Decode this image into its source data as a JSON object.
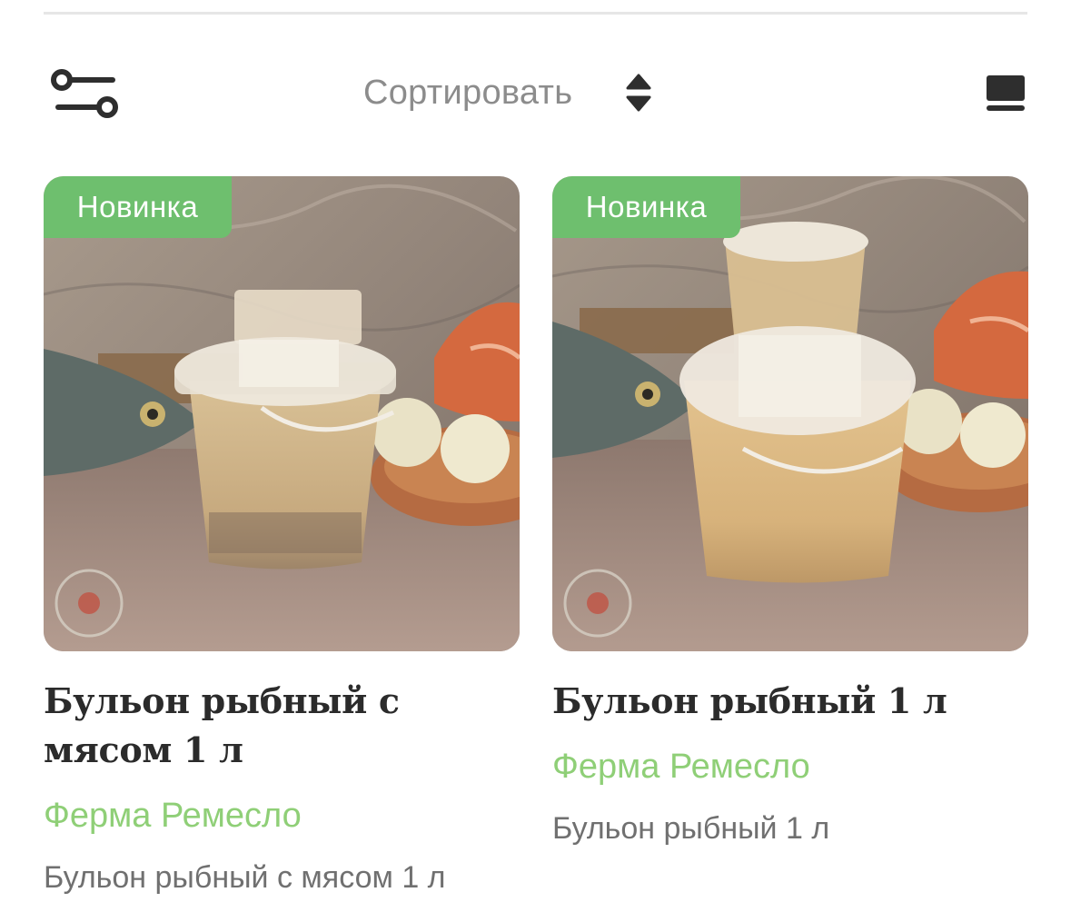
{
  "toolbar": {
    "filter_icon": "filter-sliders-icon",
    "sort_label": "Сортировать",
    "sort_icon": "sort-up-down-icon",
    "view_icon": "view-toggle-icon"
  },
  "colors": {
    "badge": "#6ebf6e",
    "brand": "#8fcf77",
    "title": "#2b2b2b",
    "description": "#707070",
    "sort_label": "#8c8c8c"
  },
  "products": [
    {
      "badge": "Новинка",
      "title": "Бульон рыбный с мясом 1 л",
      "brand": "Ферма Ремесло",
      "description": "Бульон рыбный с мясом 1 л"
    },
    {
      "badge": "Новинка",
      "title": "Бульон рыбный 1 л",
      "brand": "Ферма Ремесло",
      "description": "Бульон рыбный 1 л"
    }
  ]
}
